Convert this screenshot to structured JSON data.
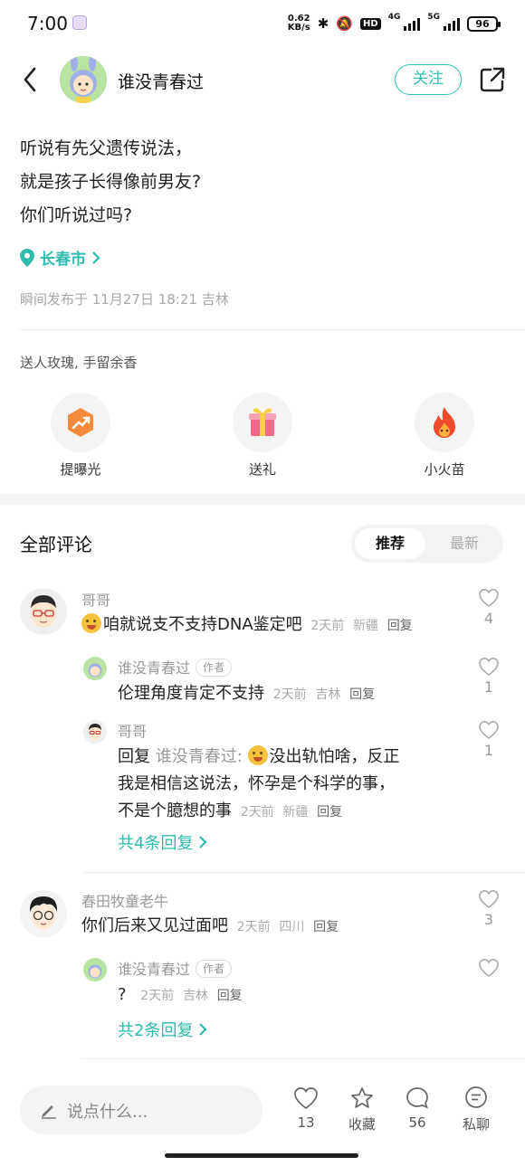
{
  "status_bar": {
    "time": "7:00",
    "speed_value": "0.62",
    "speed_unit": "KB/s",
    "hd_label": "HD",
    "net1": "4G",
    "net2": "5G",
    "battery": "96"
  },
  "header": {
    "author_name": "谁没青春过",
    "follow_label": "关注"
  },
  "post": {
    "lines": [
      "听说有先父遗传说法，",
      "就是孩子长得像前男友?",
      "你们听说过吗?"
    ],
    "location": "长春市",
    "meta": "瞬间发布于 11月27日 18:21 吉林"
  },
  "gifts": {
    "title": "送人玫瑰, 手留余香",
    "items": [
      {
        "label": "提曝光",
        "icon": "boost-icon"
      },
      {
        "label": "送礼",
        "icon": "gift-box-icon"
      },
      {
        "label": "小火苗",
        "icon": "flame-icon"
      }
    ]
  },
  "comments_section": {
    "title": "全部评论",
    "sort_recommended": "推荐",
    "sort_latest": "最新"
  },
  "comments": [
    {
      "name": "哥哥",
      "text": "咱就说支不支持DNA鉴定吧",
      "time": "2天前",
      "region": "新疆",
      "reply": "回复",
      "likes": "4",
      "replies": [
        {
          "name": "谁没青春过",
          "tag": "作者",
          "text": "伦理角度肯定不支持",
          "time": "2天前",
          "region": "吉林",
          "reply": "回复",
          "likes": "1"
        },
        {
          "name": "哥哥",
          "prefix": "回复",
          "quote": "谁没青春过:",
          "text1": "没出轨怕啥，反正",
          "text2": "我是相信这说法，怀孕是个科学的事，",
          "text3": "不是个臆想的事",
          "time": "2天前",
          "region": "新疆",
          "reply": "回复",
          "likes": "1"
        }
      ],
      "more": "共4条回复"
    },
    {
      "name": "春田牧童老牛",
      "text": "你们后来又见过面吧",
      "time": "2天前",
      "region": "四川",
      "reply": "回复",
      "likes": "3",
      "replies": [
        {
          "name": "谁没青春过",
          "tag": "作者",
          "text": "?",
          "time": "2天前",
          "region": "吉林",
          "reply": "回复",
          "likes": ""
        }
      ],
      "more": "共2条回复"
    }
  ],
  "bottom_bar": {
    "placeholder": "说点什么...",
    "like_count": "13",
    "collect_label": "收藏",
    "comment_count": "56",
    "chat_label": "私聊"
  },
  "colors": {
    "accent": "#2fbcae",
    "text": "#222222",
    "muted": "#aaaaaa"
  }
}
